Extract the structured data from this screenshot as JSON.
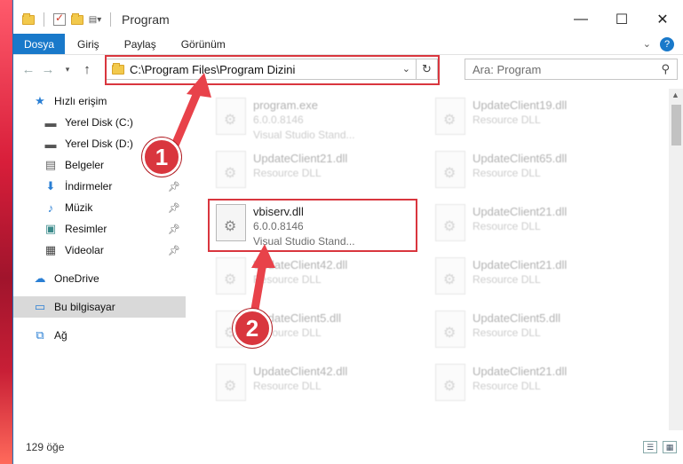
{
  "window": {
    "title": "Program",
    "minimize": "—",
    "maximize": "☐",
    "close": "✕"
  },
  "ribbon": {
    "tabs": [
      "Dosya",
      "Giriş",
      "Paylaş",
      "Görünüm"
    ],
    "help": "?"
  },
  "address": {
    "path": "C:\\Program Files\\Program Dizini",
    "search_placeholder": "Ara: Program"
  },
  "sidebar": {
    "items": [
      {
        "label": "Hızlı erişim",
        "icon": "star-icon"
      },
      {
        "label": "Yerel Disk (C:)",
        "icon": "drive-icon"
      },
      {
        "label": "Yerel Disk (D:)",
        "icon": "drive-icon"
      },
      {
        "label": "Belgeler",
        "icon": "documents-icon"
      },
      {
        "label": "İndirmeler",
        "icon": "download-icon"
      },
      {
        "label": "Müzik",
        "icon": "music-icon"
      },
      {
        "label": "Resimler",
        "icon": "pictures-icon"
      },
      {
        "label": "Videolar",
        "icon": "video-icon"
      },
      {
        "label": "OneDrive",
        "icon": "cloud-icon"
      },
      {
        "label": "Bu bilgisayar",
        "icon": "computer-icon"
      },
      {
        "label": "Ağ",
        "icon": "network-icon"
      }
    ]
  },
  "files": {
    "col1": [
      {
        "name": "program.exe",
        "version": "6.0.0.8146",
        "desc": "Visual Studio Stand..."
      },
      {
        "name": "UpdateClient21.dll",
        "version": "",
        "desc": "Resource DLL"
      },
      {
        "name": "vbiserv.dll",
        "version": "6.0.0.8146",
        "desc": "Visual Studio Stand..."
      },
      {
        "name": "UpdateClient42.dll",
        "version": "",
        "desc": "Resource DLL"
      },
      {
        "name": "UpdateClient5.dll",
        "version": "",
        "desc": "Resource DLL"
      },
      {
        "name": "UpdateClient42.dll",
        "version": "",
        "desc": "Resource DLL"
      }
    ],
    "col2": [
      {
        "name": "UpdateClient19.dll",
        "version": "",
        "desc": "Resource DLL"
      },
      {
        "name": "UpdateClient65.dll",
        "version": "",
        "desc": "Resource DLL"
      },
      {
        "name": "UpdateClient21.dll",
        "version": "",
        "desc": "Resource DLL"
      },
      {
        "name": "UpdateClient21.dll",
        "version": "",
        "desc": "Resource DLL"
      },
      {
        "name": "UpdateClient5.dll",
        "version": "",
        "desc": "Resource DLL"
      },
      {
        "name": "UpdateClient21.dll",
        "version": "",
        "desc": "Resource DLL"
      }
    ]
  },
  "status": {
    "count": "129 öğe"
  },
  "annotations": {
    "step1": "1",
    "step2": "2"
  },
  "colors": {
    "accent": "#1979ca",
    "highlight": "#d9363e"
  }
}
